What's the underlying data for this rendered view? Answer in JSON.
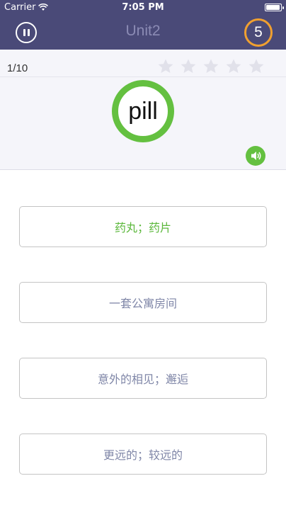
{
  "status_bar": {
    "carrier": "Carrier",
    "time": "7:05 PM"
  },
  "nav": {
    "title": "Unit2",
    "timer_value": "5"
  },
  "card": {
    "progress": "1/10",
    "stars_total": 5,
    "stars_filled": 0,
    "word": "pill"
  },
  "options": [
    {
      "label": "药丸；药片",
      "state": "correct"
    },
    {
      "label": "一套公寓房间",
      "state": "normal"
    },
    {
      "label": "意外的相见；邂逅",
      "state": "normal"
    },
    {
      "label": "更远的；较远的",
      "state": "normal"
    }
  ],
  "colors": {
    "nav_bg": "#4a4a78",
    "accent_green": "#64c040",
    "timer_ring": "#f0a030",
    "option_text": "#8087a8",
    "star_empty": "#e1e1ea"
  },
  "icons": {
    "pause": "pause-icon",
    "speaker": "speaker-icon",
    "star": "star-icon",
    "wifi": "wifi-icon",
    "battery": "battery-icon"
  }
}
